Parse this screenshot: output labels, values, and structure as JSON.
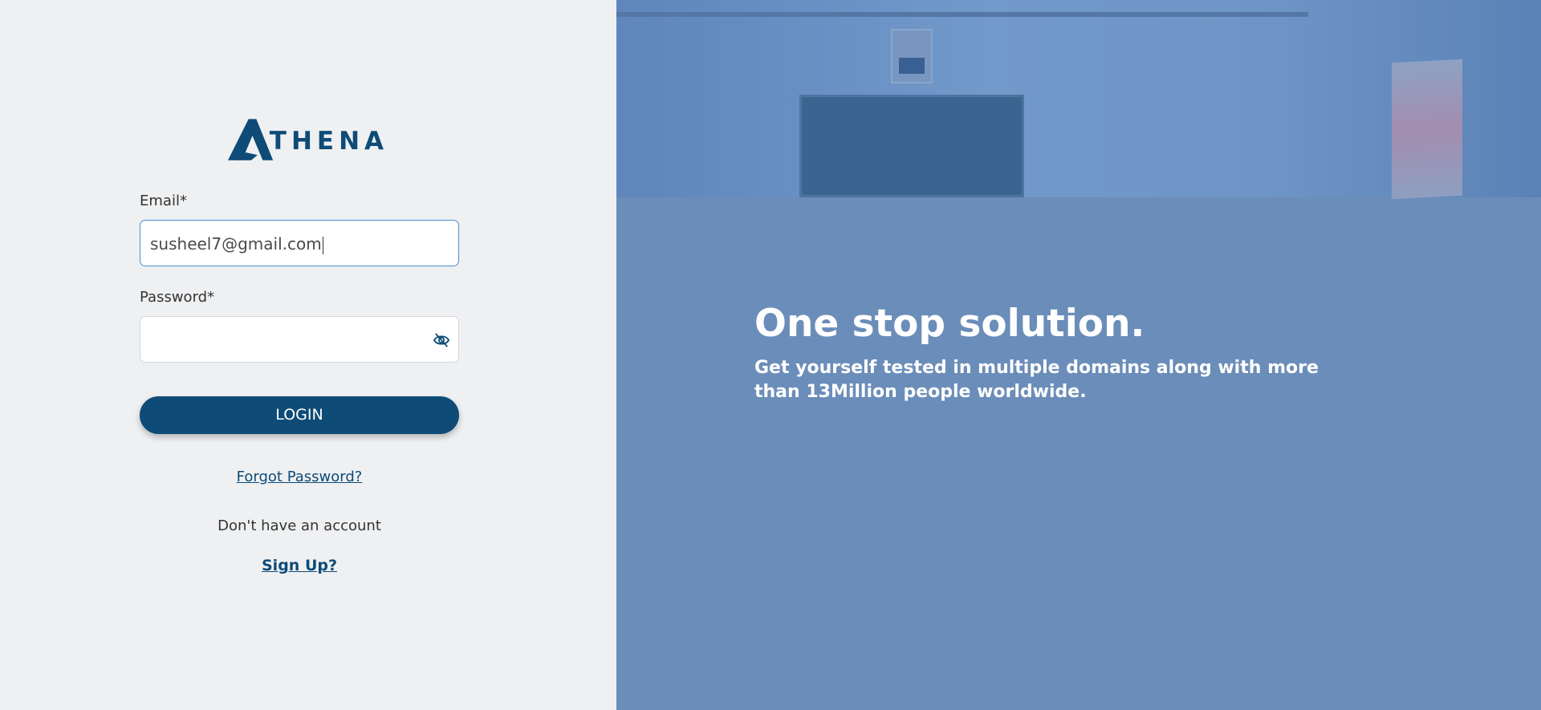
{
  "brand": {
    "name": "THENA",
    "color": "#0e4b77"
  },
  "form": {
    "email_label": "Email*",
    "email_value": "susheel7@gmail.com",
    "password_label": "Password*",
    "password_value": "",
    "password_toggle_icon": "eye-off-icon",
    "login_label": "LOGIN",
    "forgot_label": "Forgot Password?",
    "no_account_text": "Don't have an account",
    "signup_label": "Sign Up?"
  },
  "hero": {
    "title": "One stop solution.",
    "subtitle": "Get yourself tested in multiple domains along with more than 13Million people worldwide."
  },
  "colors": {
    "left_bg": "#eff0f2",
    "right_bg": "#6b8db9",
    "accent": "#0e4b77",
    "focus_border": "#4b8fd1"
  }
}
